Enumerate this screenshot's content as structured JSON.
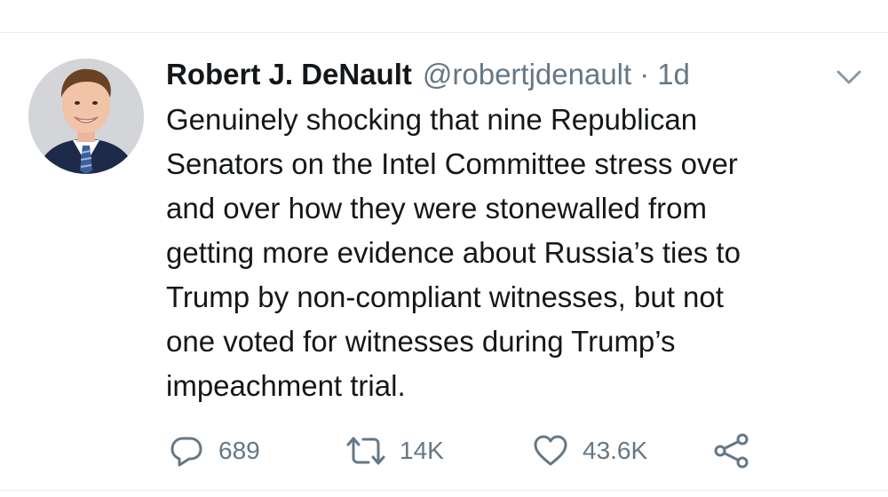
{
  "tweet": {
    "author": {
      "display_name": "Robert J. DeNault",
      "handle": "@robertjdenault",
      "separator": "·",
      "timestamp": "1d",
      "avatar_icon": "profile-photo"
    },
    "text_lines": [
      "Genuinely shocking that nine Republican",
      "Senators on the Intel Committee stress over",
      "and over how they were stonewalled from",
      "getting more evidence about Russia’s ties to",
      "Trump by non-compliant witnesses, but not",
      "one voted for witnesses during Trump’s",
      "impeachment trial."
    ],
    "actions": {
      "reply": {
        "icon": "reply-icon",
        "count": "689"
      },
      "retweet": {
        "icon": "retweet-icon",
        "count": "14K"
      },
      "like": {
        "icon": "heart-icon",
        "count": "43.6K"
      },
      "share": {
        "icon": "share-icon"
      }
    },
    "menu_icon": "chevron-down-icon"
  },
  "colors": {
    "text_primary": "#14171a",
    "text_secondary": "#657786",
    "divider": "#e6ecf0"
  }
}
